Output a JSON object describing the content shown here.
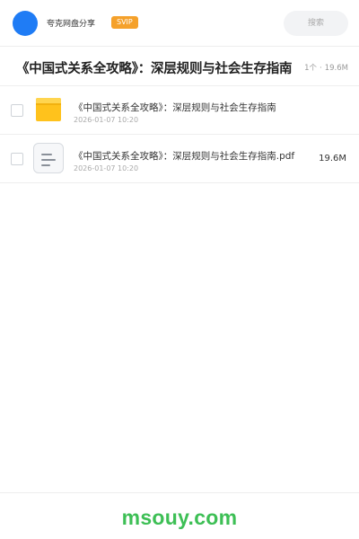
{
  "header": {
    "brand": "夸克网盘分享",
    "badge": "SVIP",
    "search_placeholder": "搜索",
    "accent": "#1f7cf5",
    "badge_color": "#f5a12b"
  },
  "share": {
    "title": "《中国式关系全攻略》：深层规则与社会生存指南",
    "meta_count": "1个",
    "meta_size": "19.6M"
  },
  "files": [
    {
      "name": "《中国式关系全攻略》：深层规则与社会生存指南",
      "date": "2026-01-07 10:20",
      "size": "",
      "icon": "folder-icon"
    },
    {
      "name": "《中国式关系全攻略》：深层规则与社会生存指南.pdf",
      "date": "2026-01-07 10:20",
      "size": "19.6M",
      "icon": "document-icon"
    }
  ],
  "footer": {
    "watermark": "msouy.com",
    "watermark_color": "#3dbf55"
  }
}
